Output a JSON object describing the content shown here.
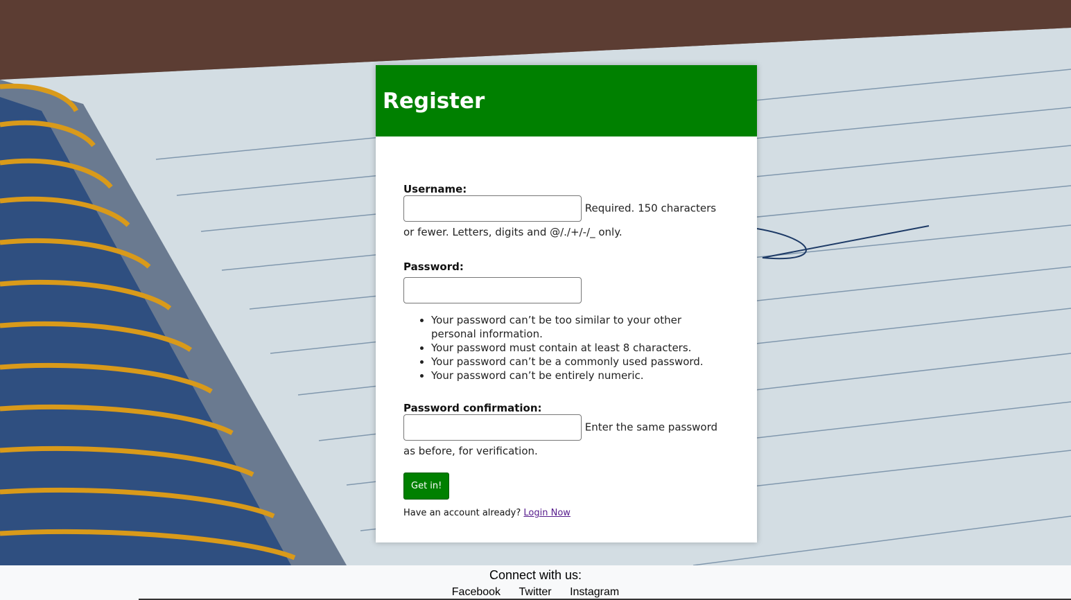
{
  "header": {
    "title": "Register"
  },
  "form": {
    "username": {
      "label": "Username:",
      "value": "",
      "help": "Required. 150 characters or fewer. Letters, digits and @/./+/-/_ only."
    },
    "password": {
      "label": "Password:",
      "value": "",
      "rules": [
        "Your password can’t be too similar to your other personal information.",
        "Your password must contain at least 8 characters.",
        "Your password can’t be a commonly used password.",
        "Your password can’t be entirely numeric."
      ]
    },
    "password_confirmation": {
      "label": "Password confirmation:",
      "value": "",
      "help": "Enter the same password as before, for verification."
    },
    "submit_label": "Get in!",
    "have_account_text": "Have an account already?",
    "login_link": "Login Now"
  },
  "footer": {
    "title": "Connect with us:",
    "links": [
      "Facebook",
      "Twitter",
      "Instagram"
    ]
  },
  "colors": {
    "header_bg": "#008000",
    "button_bg": "#008000",
    "link": "#551a8b"
  }
}
